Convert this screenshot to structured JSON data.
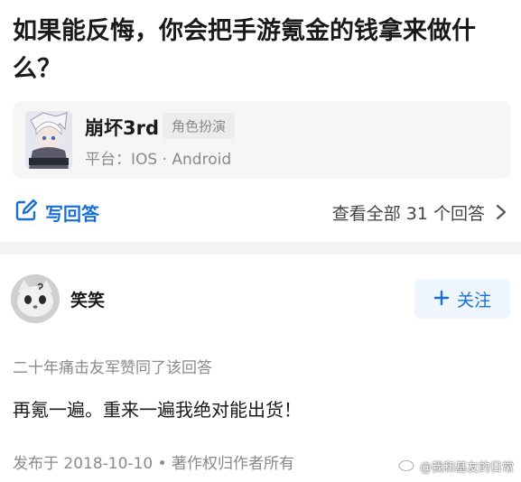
{
  "question": {
    "title": "如果能反悔，你会把手游氪金的钱拿来做什么？"
  },
  "game_card": {
    "name": "崩坏3rd",
    "tag": "角色扮演",
    "platform": "平台：IOS · Android"
  },
  "actions": {
    "write_answer": "写回答",
    "view_all": "查看全部 31 个回答"
  },
  "answer": {
    "author": "笑笑",
    "follow_label": "关注",
    "upvote_note": "二十年痛击友军赞同了该回答",
    "content": "再氪一遍。重来一遍我绝对能出货！",
    "publish_info": "发布于 2018-10-10 • 著作权归作者所有"
  },
  "watermark": {
    "text": "@我和基友的日常"
  },
  "colors": {
    "accent": "#1a6fd6",
    "muted_text": "#8a8a8a",
    "card_bg": "#f6f6f6"
  }
}
